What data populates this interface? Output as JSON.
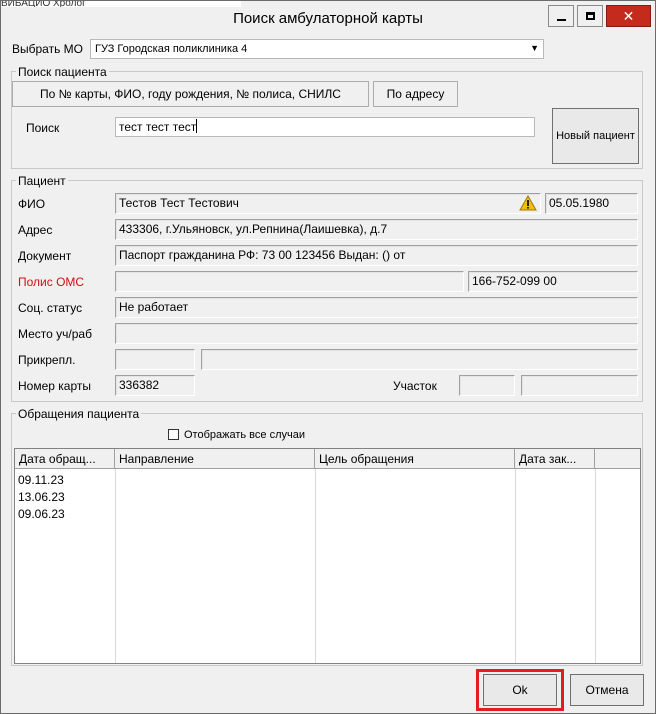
{
  "window": {
    "title": "Поиск амбулаторной карты",
    "behind_text": "ВИБАЦИО            Хролог"
  },
  "mo": {
    "label": "Выбрать МО",
    "value": "ГУЗ Городская поликлиника 4"
  },
  "search": {
    "group_title": "Поиск пациента",
    "tabs": [
      {
        "label": "По № карты, ФИО, году рождения, № полиса, СНИЛС"
      },
      {
        "label": "По адресу"
      }
    ],
    "label": "Поиск",
    "value": "тест тест тест",
    "new_patient_label": "Новый пациент"
  },
  "patient": {
    "group_title": "Пациент",
    "fio_label": "ФИО",
    "fio": "Тестов Тест Тестович",
    "birth_date": "05.05.1980",
    "address_label": "Адрес",
    "address": "433306, г.Ульяновск, ул.Репнина(Лаишевка), д.7",
    "document_label": "Документ",
    "document": "Паспорт гражданина РФ: 73 00 123456 Выдан: () от",
    "oms_label": "Полис ОМС",
    "oms": "",
    "snils": "166-752-099 00",
    "social_label": "Соц. статус",
    "social": "Не работает",
    "work_label": "Место уч/раб",
    "work": "",
    "attach_label": "Прикрепл.",
    "attach_code": "",
    "attach_name": "",
    "card_label": "Номер карты",
    "card": "336382",
    "district_label": "Участок",
    "district_code": "",
    "district_name": ""
  },
  "visits": {
    "group_title": "Обращения пациента",
    "show_all_label": "Отображать все случаи",
    "columns": [
      "Дата обращ...",
      "Направление",
      "Цель обращения",
      "Дата зак..."
    ],
    "rows": [
      {
        "date": "09.11.23"
      },
      {
        "date": "13.06.23"
      },
      {
        "date": "09.06.23"
      }
    ]
  },
  "footer": {
    "ok_label": "Ok",
    "cancel_label": "Отмена"
  },
  "colors": {
    "accent_red": "#e02020",
    "oms_label_red": "#d01010",
    "warning_yellow": "#f2c200"
  }
}
